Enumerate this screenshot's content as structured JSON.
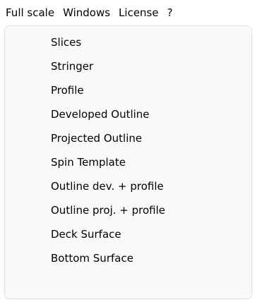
{
  "menubar": {
    "items": [
      {
        "label": "Full scale"
      },
      {
        "label": "Windows"
      },
      {
        "label": "License"
      },
      {
        "label": "?"
      }
    ]
  },
  "dropdown": {
    "items": [
      {
        "label": "Slices"
      },
      {
        "label": "Stringer"
      },
      {
        "label": "Profile"
      },
      {
        "label": "Developed Outline"
      },
      {
        "label": "Projected Outline"
      },
      {
        "label": "Spin Template"
      },
      {
        "label": "Outline dev. + profile"
      },
      {
        "label": "Outline proj. + profile"
      },
      {
        "label": "Deck Surface"
      },
      {
        "label": "Bottom Surface"
      }
    ]
  }
}
